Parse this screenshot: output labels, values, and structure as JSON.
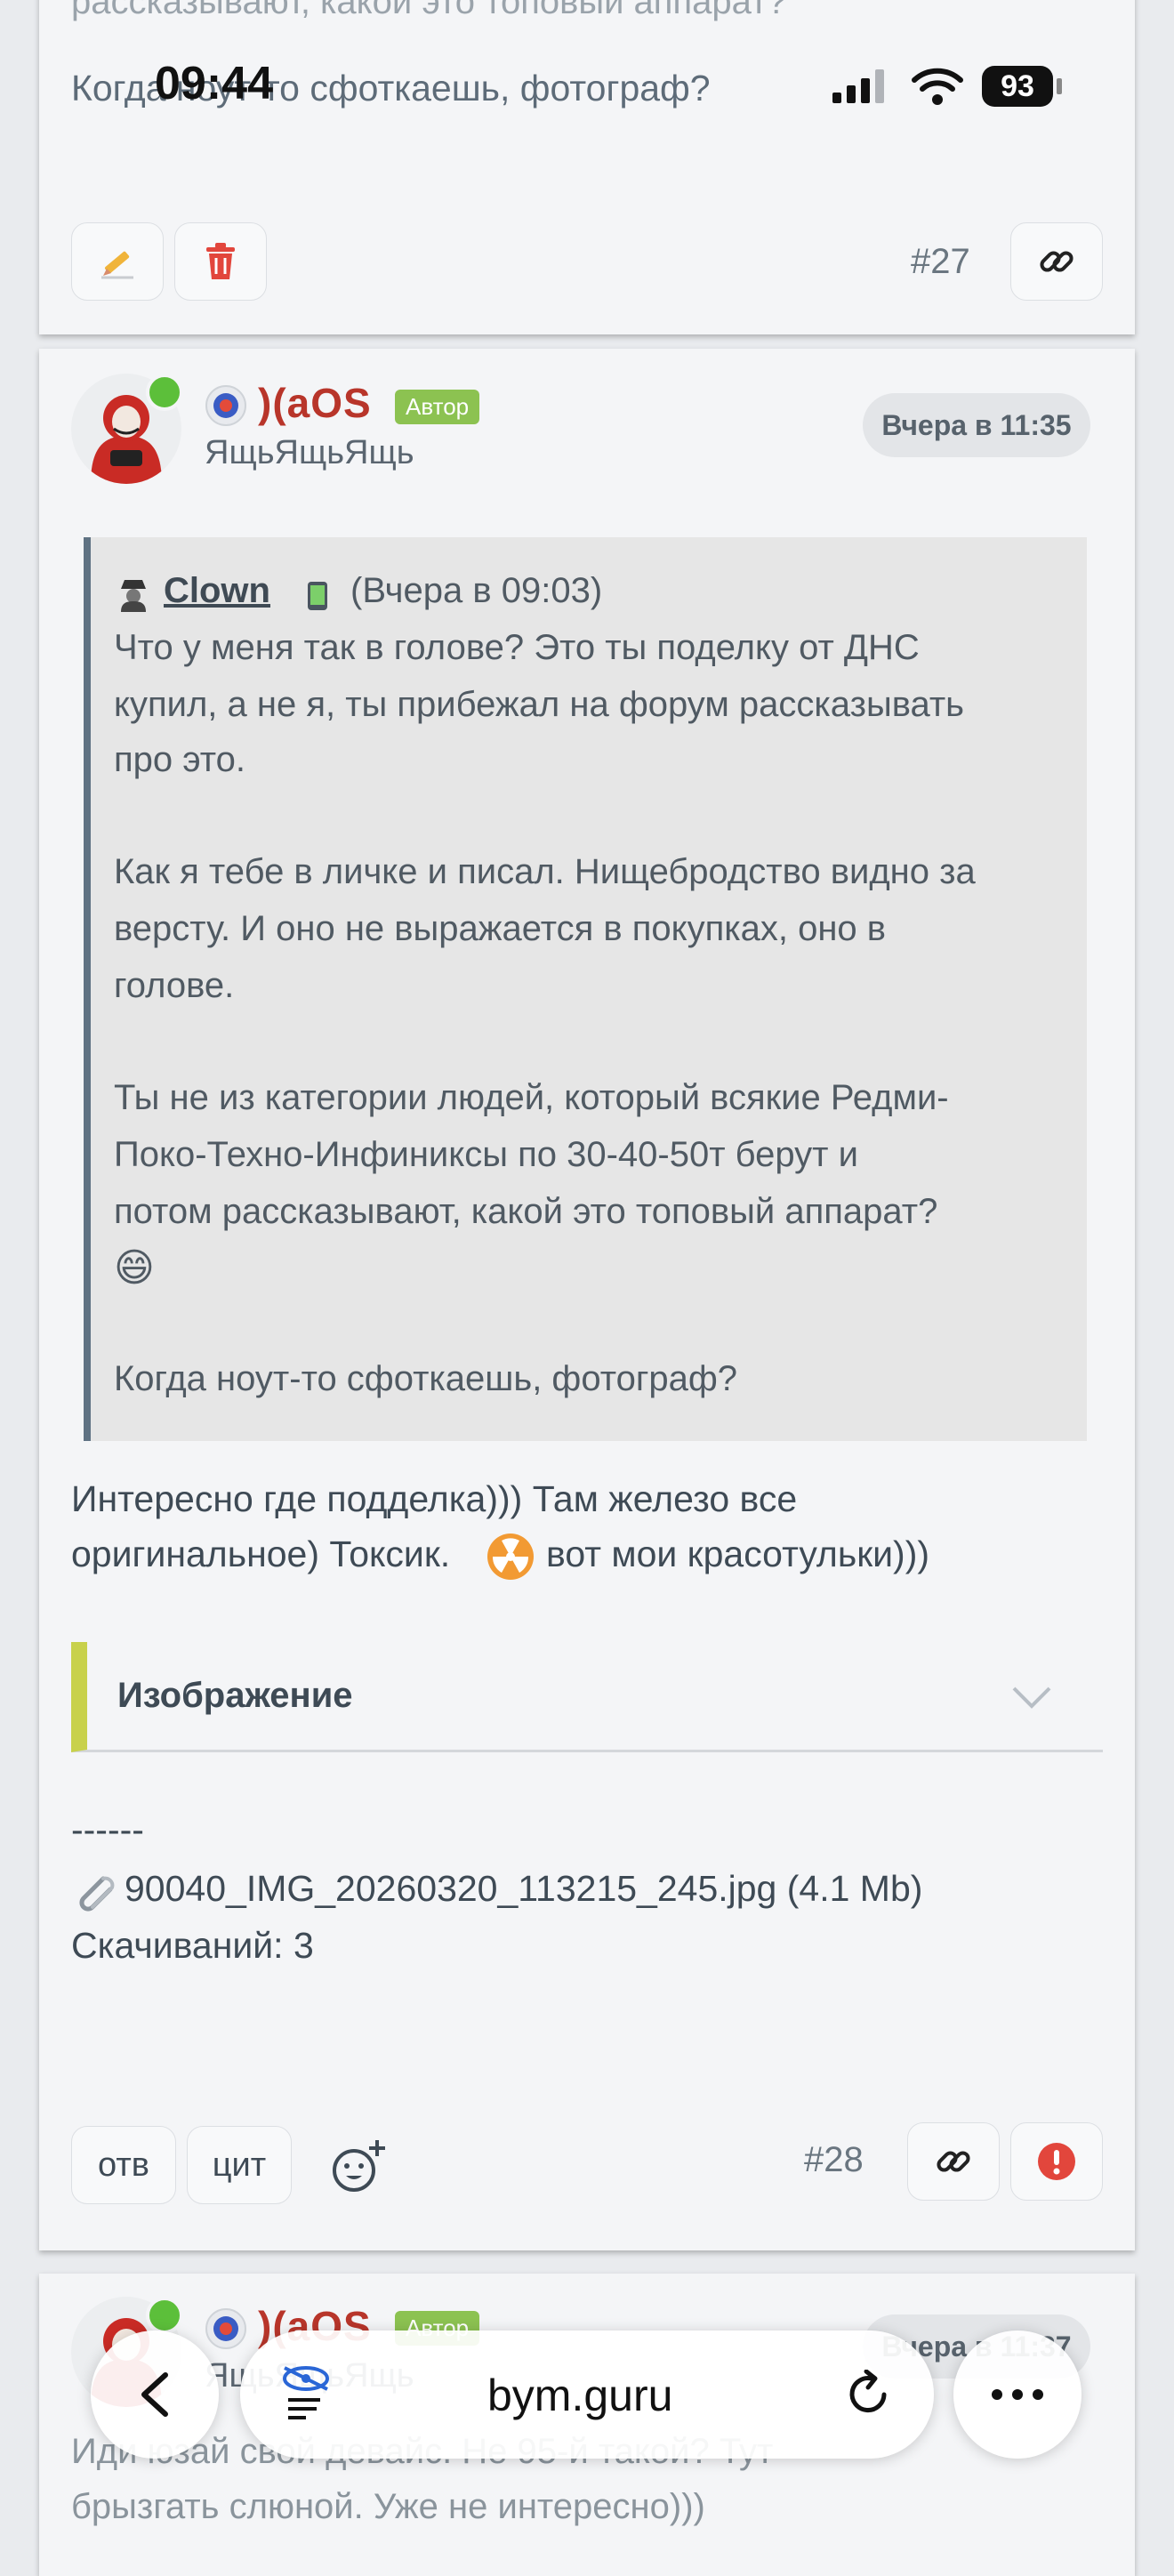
{
  "status_bar": {
    "time": "09:44",
    "battery": "93"
  },
  "prev_post": {
    "faded_line": "рассказывают, какой это топовый аппарат?",
    "last_line": "Когда ноут-то сфоткаешь, фотограф?",
    "number": "#27"
  },
  "post": {
    "username": ")(aOS",
    "badge": "Автор",
    "user_title": "ЯщьЯщьЯщь",
    "time": "Вчера в 11:35",
    "quote": {
      "author": "Clown",
      "time": "(Вчера в 09:03)",
      "lines": [
        "Что у меня так в голове? Это ты поделку от ДНС",
        "купил, а не я, ты прибежал на форум рассказывать",
        "про это.",
        "Как я тебе в личке и писал. Нищебродство видно за",
        "версту. И оно не выражается в покупках, оно в",
        "голове.",
        "Ты не из категории людей, который всякие Редми-",
        "Поко-Техно-Инфиниксы по 30-40-50т берут и",
        "потом рассказывают, какой это топовый аппарат?",
        "Когда ноут-то сфоткаешь, фотограф?"
      ],
      "emoji": "😄"
    },
    "body_line1": "Интересно где подделка))) Там железо все",
    "body_line2a": "оригинальное) Токсик.",
    "body_line2b": "вот мои красотульки)))",
    "spoiler_title": "Изображение",
    "separator": "------",
    "attachment_name": "90040_IMG_20260320_113215_245.jpg (4.1 Mb)",
    "downloads": "Скачиваний: 3",
    "reply_label": "отв",
    "quote_label": "цит",
    "number": "#28"
  },
  "next_post": {
    "username": ")(aOS",
    "badge": "Автор",
    "user_title": "ЯщьЯщьЯщь",
    "time": "Вчера в 11:37",
    "line1": "Иди юзай свой девайс. Не 95-й такой? Тут",
    "line2": "брызгать слюной. Уже не интересно)))"
  },
  "browser": {
    "url": "bym.guru"
  },
  "colors": {
    "username": "#b8352a",
    "badge": "#8cc251",
    "online": "#5cbf3a",
    "spoiler_accent": "#c8d14b",
    "quote_border": "#5f7283"
  }
}
